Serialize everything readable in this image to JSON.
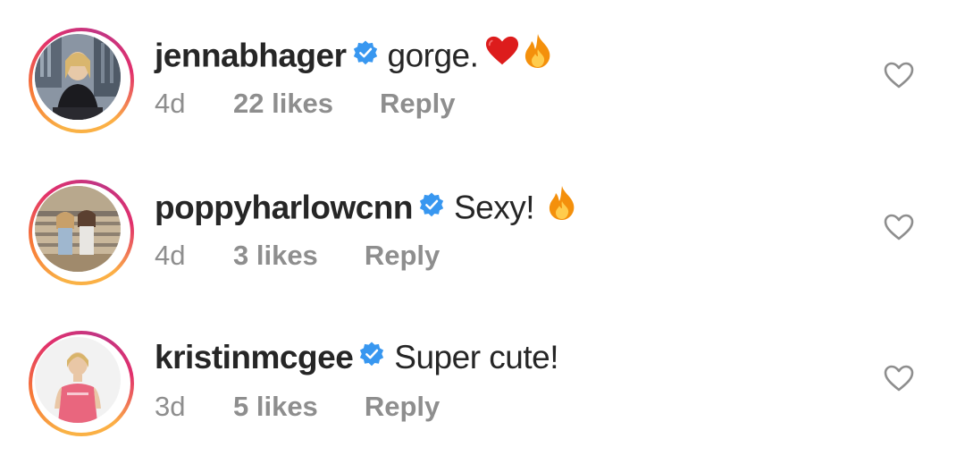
{
  "comments": [
    {
      "username": "jennabhager",
      "text": "gorge.",
      "emojis": [
        "red-heart",
        "fire"
      ],
      "age": "4d",
      "likes": "22 likes",
      "reply": "Reply",
      "verified": true
    },
    {
      "username": "poppyharlowcnn",
      "text": "Sexy!",
      "emojis": [
        "fire"
      ],
      "age": "4d",
      "likes": "3 likes",
      "reply": "Reply",
      "verified": true
    },
    {
      "username": "kristinmcgee",
      "text": "Super cute!",
      "emojis": [],
      "age": "3d",
      "likes": "5 likes",
      "reply": "Reply",
      "verified": true
    }
  ],
  "colors": {
    "verified_blue": "#3897f0",
    "meta_gray": "#8e8e8e",
    "text_dark": "#262626",
    "heart_outline": "#8e8e8e"
  },
  "icons": {
    "verified": "verified-badge-icon",
    "like": "heart-outline-icon",
    "fire": "fire-emoji-icon",
    "red_heart": "red-heart-emoji-icon"
  }
}
